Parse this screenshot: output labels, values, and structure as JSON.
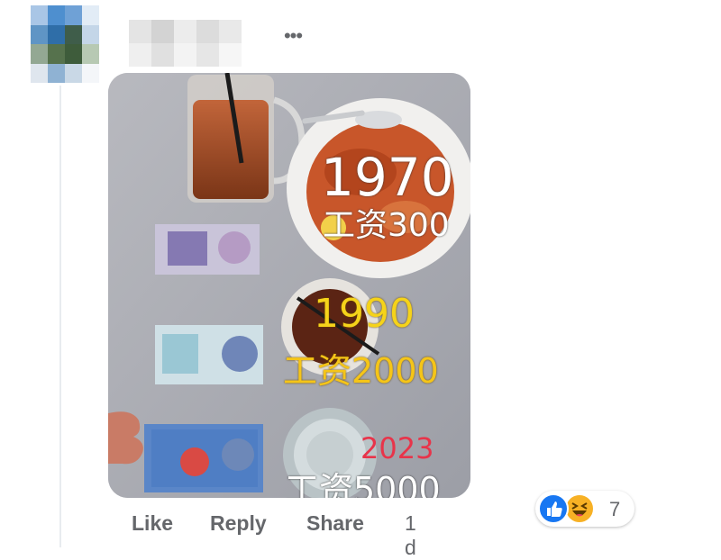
{
  "comment": {
    "author_name": "",
    "photo": {
      "overlays": [
        {
          "id": "year_1970",
          "text": "1970",
          "color": "#ffffff"
        },
        {
          "id": "salary_1970",
          "text": "工资300",
          "color": "#ffffff"
        },
        {
          "id": "year_1990",
          "text": "1990",
          "color": "#f5d31a"
        },
        {
          "id": "salary_1990",
          "text": "工资2000",
          "color": "#f5c518"
        },
        {
          "id": "year_2023",
          "text": "2023",
          "color": "#e8344a"
        },
        {
          "id": "salary_2023",
          "text": "工资5000",
          "color": "#ffffff"
        }
      ]
    },
    "actions": {
      "like": "Like",
      "reply": "Reply",
      "share": "Share",
      "timestamp": "1 d"
    },
    "reactions": {
      "icons": [
        "like-icon",
        "haha-icon"
      ],
      "count": "7",
      "like_color": "#1877f2",
      "haha_color": "#f7b125"
    }
  }
}
